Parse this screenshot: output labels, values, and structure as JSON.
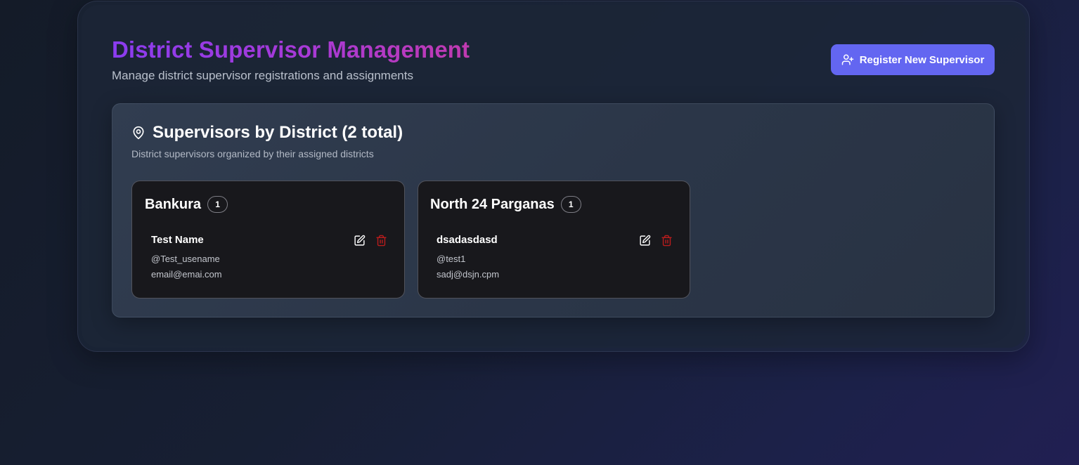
{
  "header": {
    "title": "District Supervisor Management",
    "subtitle": "Manage district supervisor registrations and assignments",
    "register_button_label": "Register New Supervisor"
  },
  "section": {
    "title": "Supervisors by District (2 total)",
    "description": "District supervisors organized by their assigned districts"
  },
  "districts": [
    {
      "name": "Bankura",
      "count": "1",
      "supervisors": [
        {
          "name": "Test Name",
          "username": "@Test_usename",
          "email": "email@emai.com"
        }
      ]
    },
    {
      "name": "North 24 Parganas",
      "count": "1",
      "supervisors": [
        {
          "name": "dsadasdasd",
          "username": "@test1",
          "email": "sadj@dsjn.cpm"
        }
      ]
    }
  ],
  "colors": {
    "accent": "#6366f1",
    "title_gradient_start": "#8b3cf0",
    "title_gradient_end": "#c13ab0",
    "delete": "#b91c1c",
    "card_background": "#18181c"
  },
  "icons": {
    "register": "user-plus-icon",
    "section": "map-pin-icon",
    "edit": "edit-icon",
    "delete": "trash-icon"
  }
}
